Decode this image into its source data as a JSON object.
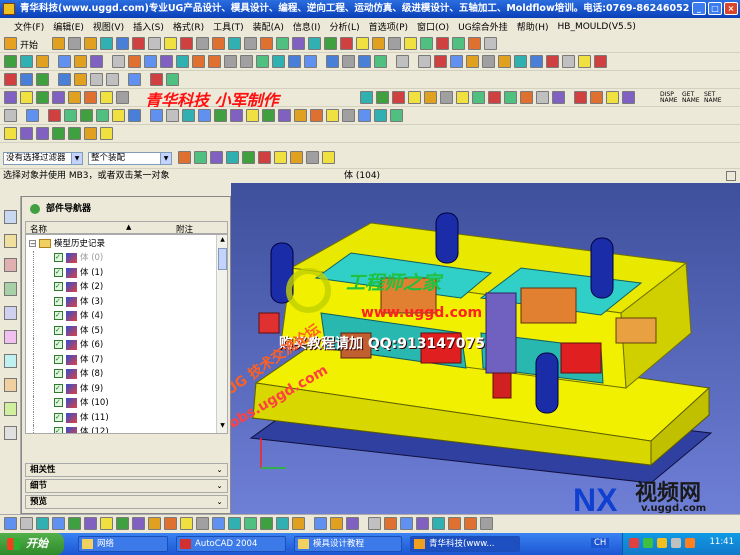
{
  "window": {
    "title": "青华科技(www.uggd.com)专业UG产品设计、模具设计、编程、逆向工程、运动仿真、级进模设计、五轴加工、Moldflow培训。电话:0769-86246052",
    "controls": [
      "_",
      "□",
      "×"
    ]
  },
  "menu": [
    "文件(F)",
    "编辑(E)",
    "视图(V)",
    "插入(S)",
    "格式(R)",
    "工具(T)",
    "装配(A)",
    "信息(I)",
    "分析(L)",
    "首选项(P)",
    "窗口(O)",
    "UG综合外挂",
    "帮助(H)",
    "HB_MOULD(V5.5)"
  ],
  "toolbar": {
    "start_label": "开始",
    "watermark_text": "青华科技 小军制作",
    "macro_labels": [
      "DISP NAME",
      "GET NAME",
      "SET NAME"
    ]
  },
  "filters": {
    "selection_filter": "没有选择过滤器",
    "assembly_scope": "整个装配"
  },
  "status": {
    "prompt": "选择对象并使用 MB3，或者双击某一对象",
    "selection": "体 (104)"
  },
  "navigator": {
    "title": "部件导航器",
    "columns": [
      "名称",
      "附注"
    ],
    "root": "模型历史记录",
    "items": [
      "体 (0)",
      "体 (1)",
      "体 (2)",
      "体 (3)",
      "体 (4)",
      "体 (5)",
      "体 (6)",
      "体 (7)",
      "体 (8)",
      "体 (9)",
      "体 (10)",
      "体 (11)",
      "体 (12)"
    ],
    "sections": [
      "相关性",
      "细节",
      "预览"
    ]
  },
  "overlays": {
    "logo_text": "工程师之家",
    "url": "www.uggd.com",
    "purchase": "购买教程请加 QQ:913147075",
    "forum_text": "UG 技术交流论坛",
    "forum_url": "bbs.uggd.com",
    "nx_logo": "NX",
    "nx_site_name": "视频网",
    "nx_url": "v.uggd.com"
  },
  "taskbar": {
    "start": "开始",
    "tasks": [
      "网络",
      "AutoCAD 2004",
      "模具设计教程",
      "青华科技(www..."
    ],
    "lang": "CH",
    "time": "11:41"
  },
  "colors": {
    "title_blue": "#0a3fb8",
    "mold_yellow": "#f0f000",
    "cavity_cyan": "#30d0c8",
    "viewport_blue": "#5060c0"
  }
}
